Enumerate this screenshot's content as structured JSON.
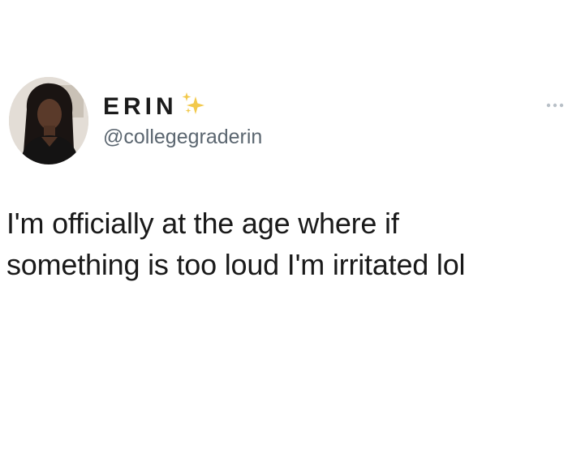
{
  "tweet": {
    "author": {
      "display_name": "ERIN",
      "name_emoji_icon": "sparkles-icon",
      "handle": "@collegegraderin",
      "avatar_icon": "profile-photo"
    },
    "more_icon": "more-options-icon",
    "text_lines": [
      "I'm officially at the age where if",
      "something is too loud I'm irritated lol"
    ]
  },
  "colors": {
    "background": "#ffffff",
    "text_primary": "#1a1a1a",
    "text_secondary": "#5b6670",
    "sparkle": "#f2c94c"
  }
}
